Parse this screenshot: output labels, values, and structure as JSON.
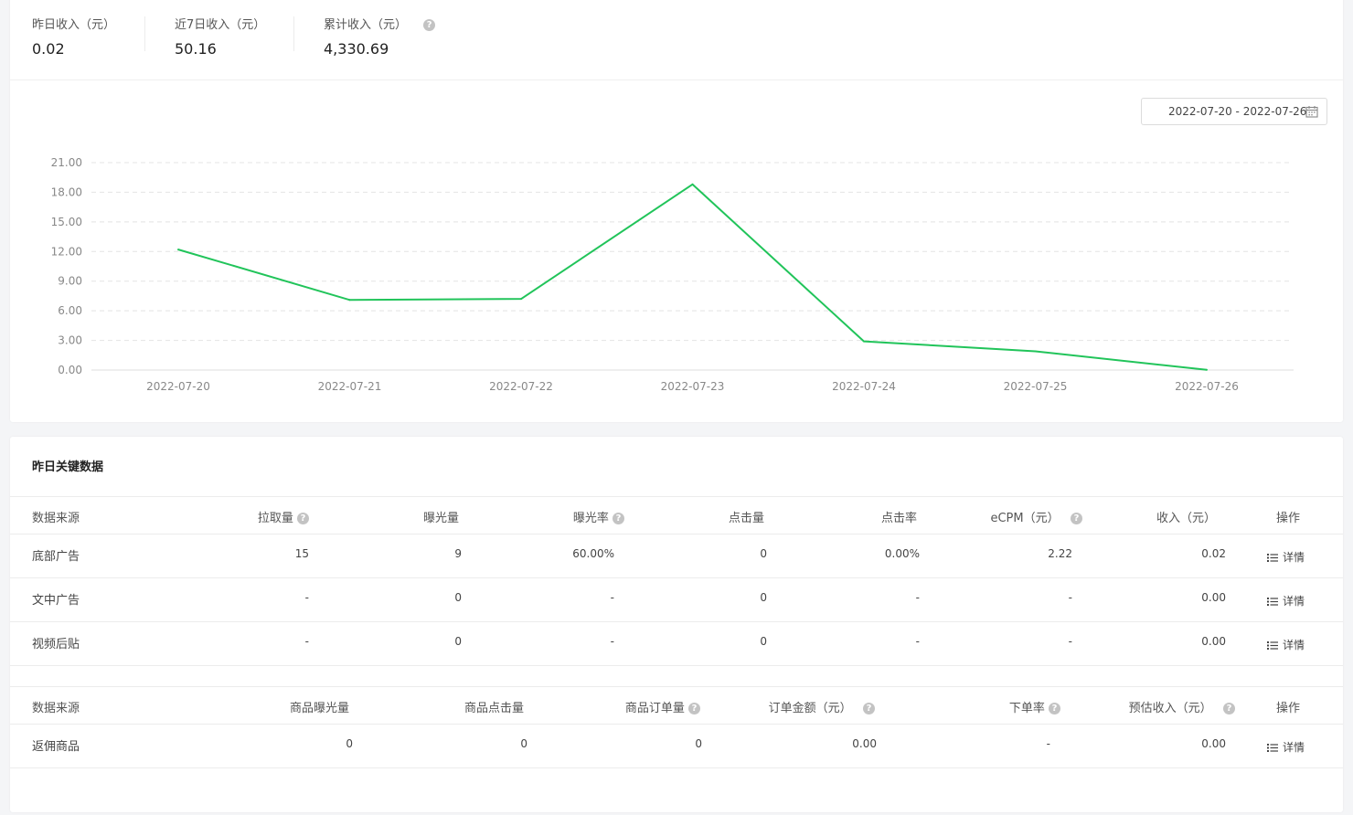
{
  "stats": [
    {
      "label": "昨日收入（元）",
      "value": "0.02"
    },
    {
      "label": "近7日收入（元）",
      "value": "50.16"
    },
    {
      "label": "累计收入（元）",
      "value": "4,330.69"
    }
  ],
  "help_glyph": "?",
  "date_range": "2022-07-20 - 2022-07-26",
  "chart_data": {
    "type": "line",
    "x": [
      "2022-07-20",
      "2022-07-21",
      "2022-07-22",
      "2022-07-23",
      "2022-07-24",
      "2022-07-25",
      "2022-07-26"
    ],
    "series": [
      {
        "values": [
          12.2,
          7.1,
          7.2,
          18.8,
          2.9,
          1.9,
          0.02
        ],
        "color": "#21c45a"
      }
    ],
    "yticks": [
      "0.00",
      "3.00",
      "6.00",
      "9.00",
      "12.00",
      "15.00",
      "18.00",
      "21.00"
    ],
    "ylim": [
      0,
      21
    ],
    "grid": true
  },
  "key_data": {
    "title": "昨日关键数据",
    "ad_table": {
      "headers": [
        "数据来源",
        "拉取量",
        "曝光量",
        "曝光率",
        "点击量",
        "点击率",
        "eCPM（元）",
        "收入（元）",
        "操作"
      ],
      "rows": [
        {
          "source": "底部广告",
          "pull": "15",
          "exposure": "9",
          "exposure_rate": "60.00%",
          "clicks": "0",
          "ctr": "0.00%",
          "ecpm": "2.22",
          "income": "0.02",
          "action": "详情"
        },
        {
          "source": "文中广告",
          "pull": "-",
          "exposure": "0",
          "exposure_rate": "-",
          "clicks": "0",
          "ctr": "-",
          "ecpm": "-",
          "income": "0.00",
          "action": "详情"
        },
        {
          "source": "视频后贴",
          "pull": "-",
          "exposure": "0",
          "exposure_rate": "-",
          "clicks": "0",
          "ctr": "-",
          "ecpm": "-",
          "income": "0.00",
          "action": "详情"
        }
      ]
    },
    "product_table": {
      "headers": [
        "数据来源",
        "商品曝光量",
        "商品点击量",
        "商品订单量",
        "订单金额（元）",
        "下单率",
        "预估收入（元）",
        "操作"
      ],
      "rows": [
        {
          "source": "返佣商品",
          "exposure": "0",
          "clicks": "0",
          "orders": "0",
          "amount": "0.00",
          "rate": "-",
          "income": "0.00",
          "action": "详情"
        }
      ]
    }
  }
}
